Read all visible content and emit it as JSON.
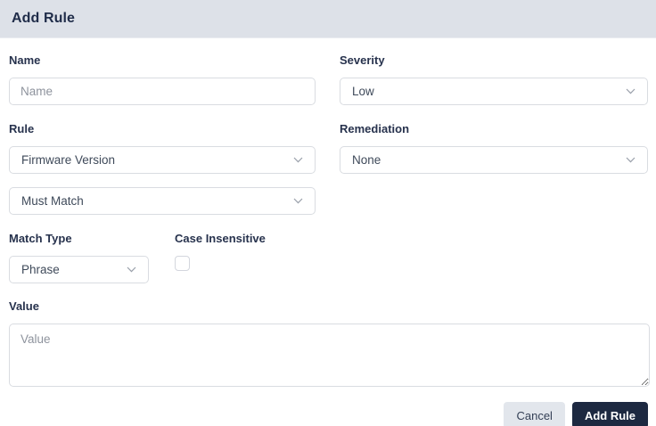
{
  "header": {
    "title": "Add Rule"
  },
  "form": {
    "name": {
      "label": "Name",
      "placeholder": "Name",
      "value": ""
    },
    "severity": {
      "label": "Severity",
      "value": "Low"
    },
    "rule": {
      "label": "Rule",
      "value": "Firmware Version"
    },
    "match_mode": {
      "value": "Must Match"
    },
    "remediation": {
      "label": "Remediation",
      "value": "None"
    },
    "match_type": {
      "label": "Match Type",
      "value": "Phrase"
    },
    "case_insensitive": {
      "label": "Case Insensitive",
      "checked": false
    },
    "value": {
      "label": "Value",
      "placeholder": "Value",
      "value": ""
    }
  },
  "footer": {
    "cancel_label": "Cancel",
    "submit_label": "Add Rule"
  },
  "colors": {
    "header_bg": "#dde1e8",
    "title_text": "#1f2c49",
    "label_text": "#27324d",
    "field_border": "#d9dce1",
    "placeholder_text": "#8e939d",
    "select_text": "#3f4a5a",
    "chevron": "#9aa0ab",
    "cancel_bg": "#e2e6ec",
    "cancel_text": "#333f55",
    "submit_bg": "#1d2941",
    "submit_text": "#ffffff"
  }
}
